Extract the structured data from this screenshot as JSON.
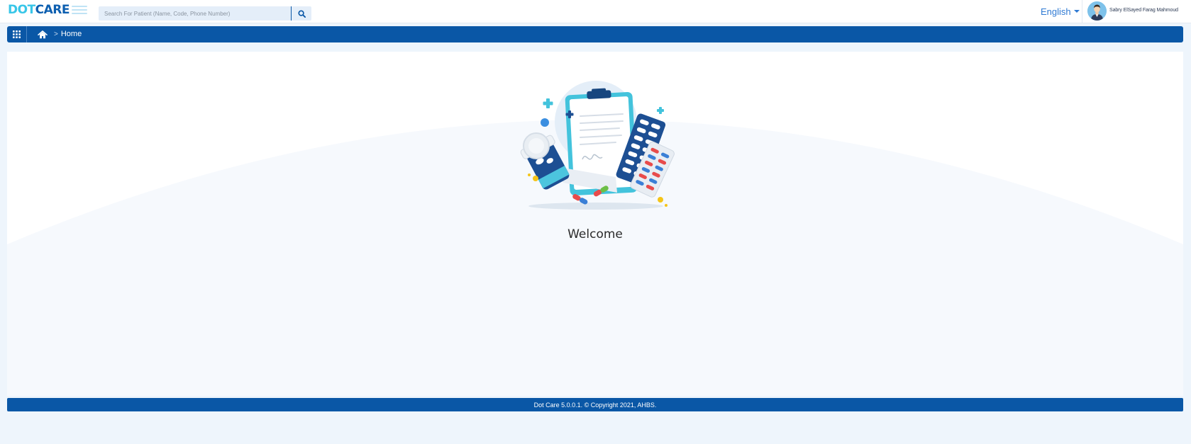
{
  "header": {
    "logo": {
      "part1": "DOT",
      "part2": "CARE"
    },
    "search": {
      "placeholder": "Search For Patient (Name, Code, Phone Number)",
      "value": "",
      "icon": "search-icon"
    },
    "language": {
      "label": "English",
      "icon": "caret-down-icon"
    },
    "user": {
      "name": "Sabry ElSayed Farag Mahmoud",
      "icon": "avatar"
    }
  },
  "breadcrumb": {
    "apps_icon": "grid-icon",
    "home_icon": "home-icon",
    "separator": ">",
    "current": "Home"
  },
  "main": {
    "illustration": "medical-clipboard-pills-illustration",
    "welcome": "Welcome"
  },
  "footer": {
    "text": "Dot Care 5.0.0.1. © Copyright 2021, AHBS."
  },
  "colors": {
    "primary": "#0a57a6",
    "logo_dot": "#38c6e8",
    "logo_care": "#0d5fb0",
    "page_bg": "#eef5fc",
    "link": "#2f7ad3"
  }
}
